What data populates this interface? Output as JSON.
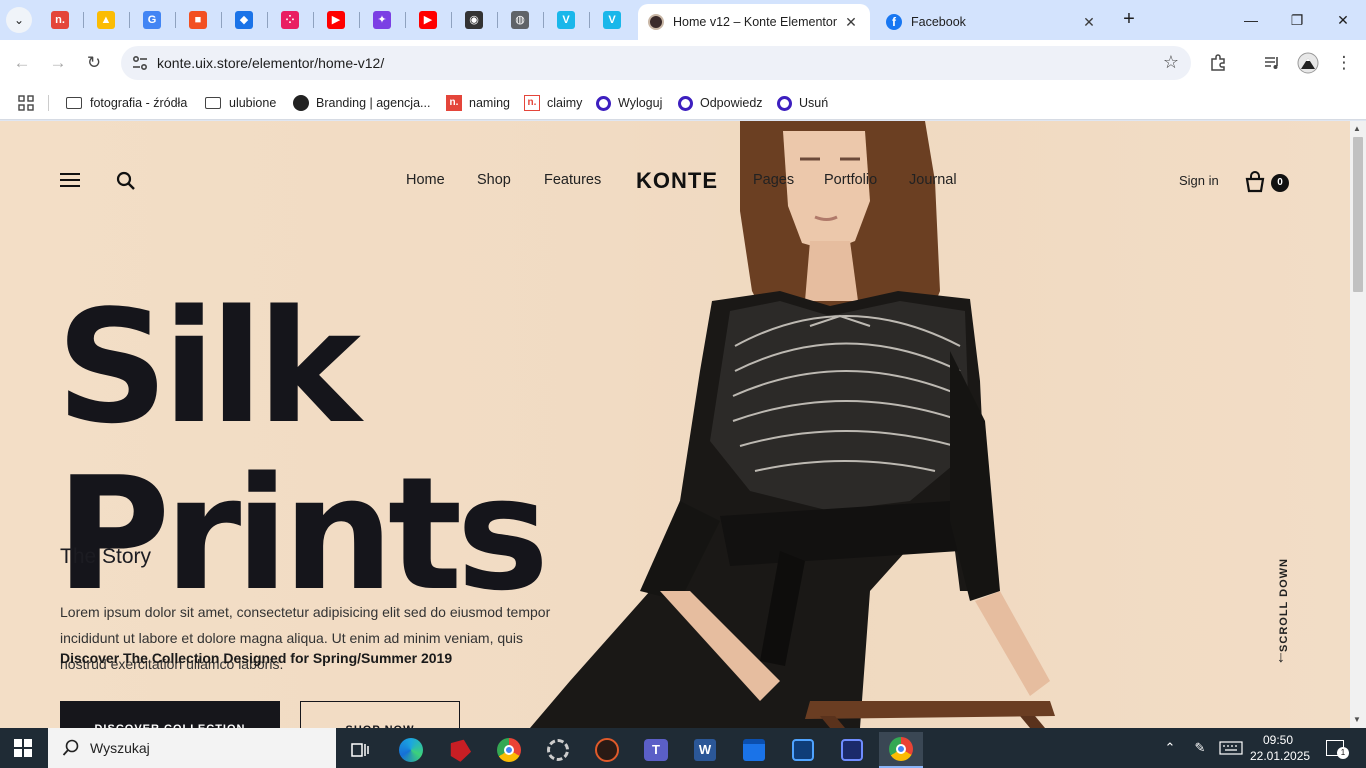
{
  "tabs": {
    "pinned": [
      {
        "name": "n-app",
        "color": "#e4453a",
        "glyph": "n."
      },
      {
        "name": "google-ads",
        "color": "#fbbc04",
        "glyph": "▲"
      },
      {
        "name": "google",
        "color": "#4285f4",
        "glyph": "G"
      },
      {
        "name": "microsoft",
        "color": "#f25022",
        "glyph": "■"
      },
      {
        "name": "shield-app",
        "color": "#1a73e8",
        "glyph": "◆"
      },
      {
        "name": "apps-grid",
        "color": "#e91e63",
        "glyph": "⁘"
      },
      {
        "name": "youtube",
        "color": "#ff0000",
        "glyph": "▶"
      },
      {
        "name": "gemini",
        "color": "#7b3fe4",
        "glyph": "✦"
      },
      {
        "name": "youtube-2",
        "color": "#ff0000",
        "glyph": "▶"
      },
      {
        "name": "circle-app",
        "color": "#333333",
        "glyph": "◉"
      },
      {
        "name": "globe",
        "color": "#5f6368",
        "glyph": "◍"
      },
      {
        "name": "vimeo",
        "color": "#1ab7ea",
        "glyph": "V"
      },
      {
        "name": "vimeo-2",
        "color": "#1ab7ea",
        "glyph": "V"
      }
    ],
    "active": {
      "title": "Home v12 – Konte Elementor",
      "close": "✕"
    },
    "other": {
      "title": "Facebook",
      "close": "✕"
    },
    "new_tab": "+"
  },
  "window": {
    "minimize": "—",
    "maximize": "❐",
    "close": "✕"
  },
  "toolbar": {
    "url": "konte.uix.store/elementor/home-v12/"
  },
  "bookmarks": [
    {
      "label": "fotografia - źródła",
      "type": "folder"
    },
    {
      "label": "ulubione",
      "type": "folder"
    },
    {
      "label": "Branding | agencja...",
      "type": "site"
    },
    {
      "label": "naming",
      "type": "n"
    },
    {
      "label": "claimy",
      "type": "n2"
    },
    {
      "label": "Wyloguj",
      "type": "ring"
    },
    {
      "label": "Odpowiedz",
      "type": "ring"
    },
    {
      "label": "Usuń",
      "type": "ring"
    }
  ],
  "site": {
    "nav": [
      "Home",
      "Shop",
      "Features",
      "Pages",
      "Portfolio",
      "Journal"
    ],
    "logo": "KONTE",
    "signin": "Sign in",
    "cart_count": "0",
    "hero_line1": "Silk",
    "hero_line2": "Prints",
    "story": "The Story",
    "lorem": "Lorem ipsum dolor sit amet, consectetur adipisicing elit sed do eiusmod tempor incididunt ut labore et dolore magna aliqua. Ut enim ad minim veniam, quis nostrud exercitation ullamco laboris.",
    "discover_text": "Discover The Collection Designed for Spring/Summer 2019",
    "btn_primary": "DISCOVER COLLECTION",
    "btn_secondary": "SHOP NOW",
    "scroll_down": "SCROLL DOWN"
  },
  "taskbar": {
    "search_placeholder": "Wyszukaj",
    "clock_time": "09:50",
    "clock_date": "22.01.2025",
    "notification_count": "1"
  }
}
